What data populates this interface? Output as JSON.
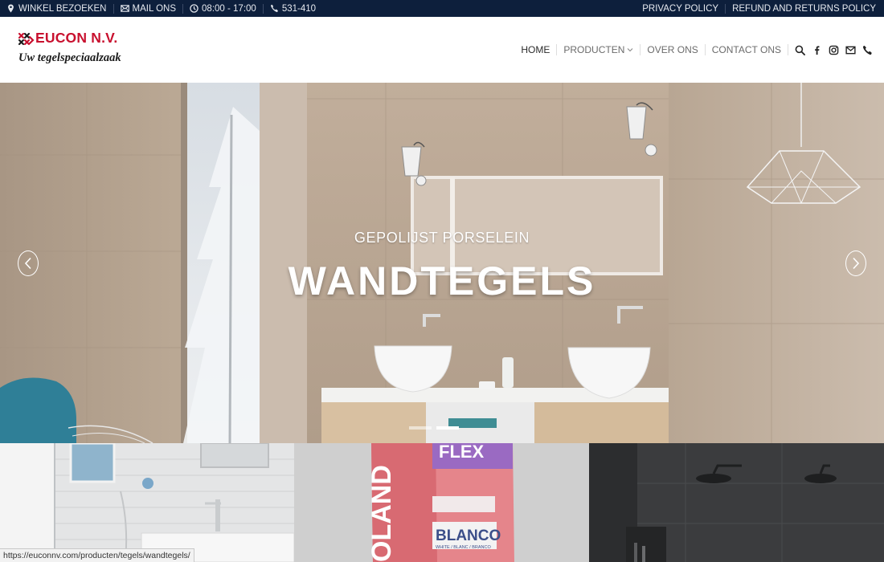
{
  "topbar": {
    "visit_label": "WINKEL BEZOEKEN",
    "mail_label": "MAIL ONS",
    "hours": "08:00 - 17:00",
    "phone": "531-410",
    "privacy": "PRIVACY POLICY",
    "refund": "REFUND AND RETURNS POLICY"
  },
  "logo": {
    "title": "EUCON N.V.",
    "tagline": "Uw tegelspeciaalzaak"
  },
  "nav": {
    "items": [
      {
        "label": "HOME"
      },
      {
        "label": "PRODUCTEN"
      },
      {
        "label": "OVER ONS"
      },
      {
        "label": "CONTACT ONS"
      }
    ],
    "icons": [
      "search-icon",
      "facebook-icon",
      "instagram-icon",
      "mail-icon",
      "phone-icon"
    ]
  },
  "hero": {
    "subtitle": "GEPOLIJST PORSELEIN",
    "title": "WANDTEGELS",
    "slide_count": 2,
    "active_slide": 2
  },
  "tiles": {
    "bag_brand": "FLEX",
    "bag_side": "OLAND",
    "bag_color": "BLANCO",
    "bag_color_sub": "WHITE / BLANC / BRANCO"
  },
  "status_url": "https://euconnv.com/producten/tegels/wandtegels/",
  "colors": {
    "topbar_bg": "#0d1f3c",
    "brand_red": "#c8102e"
  }
}
